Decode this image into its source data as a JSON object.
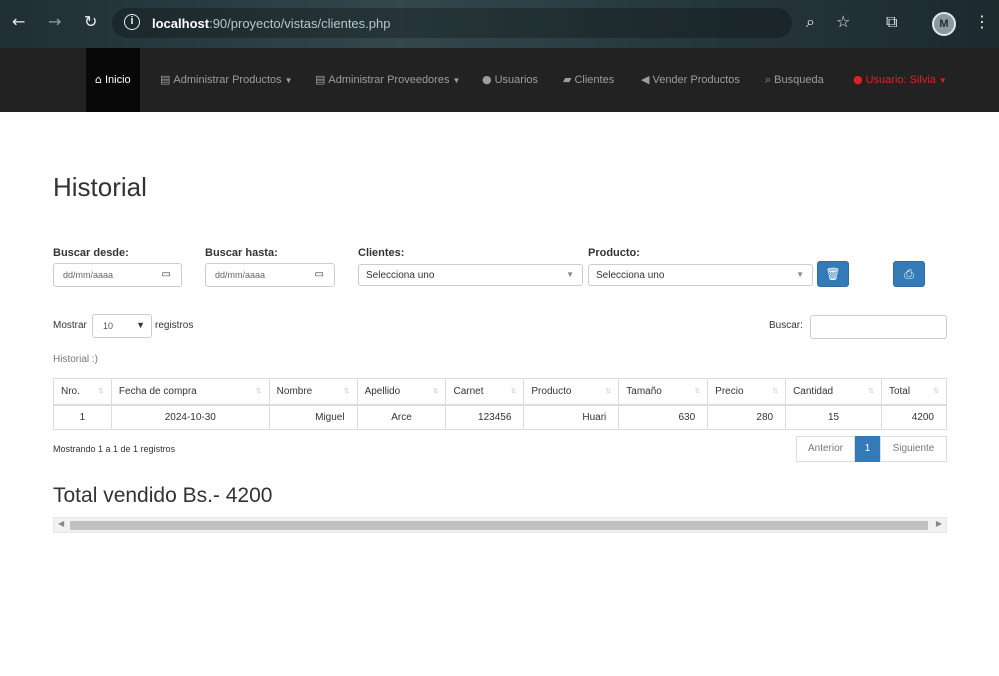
{
  "browser": {
    "back_icon": "arrow-left-icon",
    "forward_icon": "arrow-right-icon",
    "reload_icon": "reload-icon",
    "address_host": "localhost",
    "address_path": ":90/proyecto/vistas/clientes.php",
    "avatar_letter": "M"
  },
  "navbar": {
    "items": [
      {
        "label": "Inicio",
        "icon": "home-icon"
      },
      {
        "label": "Administrar Productos",
        "icon": "list-icon"
      },
      {
        "label": "Administrar Proveedores",
        "icon": "list-icon"
      },
      {
        "label": "Usuarios",
        "icon": "user-icon"
      },
      {
        "label": "Clientes",
        "icon": "folder-open-icon"
      },
      {
        "label": "Vender Productos",
        "icon": "send-icon"
      },
      {
        "label": "Busqueda",
        "icon": "search-icon"
      },
      {
        "label": "Usuario: Silvia",
        "icon": "user-icon"
      }
    ],
    "accent": "#e02020"
  },
  "page": {
    "title": "Historial",
    "filters": {
      "desde_label": "Buscar desde:",
      "hasta_label": "Buscar hasta:",
      "date_placeholder": "dd/mm/aaaa",
      "clientes_label": "Clientes:",
      "producto_label": "Producto:",
      "select_default": "Selecciona uno"
    },
    "length": {
      "prefix": "Mostrar",
      "value": "10",
      "suffix": "registros"
    },
    "search_label": "Buscar:",
    "caption": "Historial :)",
    "table": {
      "headers": [
        "Nro.",
        "Fecha de compra",
        "Nombre",
        "Apellido",
        "Carnet",
        "Producto",
        "Tamaño",
        "Precio",
        "Cantidad",
        "Total"
      ],
      "rows": [
        [
          "1",
          "2024-10-30",
          "Miguel",
          "Arce",
          "123456",
          "Huari",
          "630",
          "280",
          "15",
          "4200"
        ]
      ]
    },
    "info": "Mostrando 1 a 1 de 1 registros",
    "pagination": {
      "prev": "Anterior",
      "current": "1",
      "next": "Siguiente"
    },
    "total_text": "Total vendido Bs.- 4200",
    "primary_color": "#337ab7"
  }
}
